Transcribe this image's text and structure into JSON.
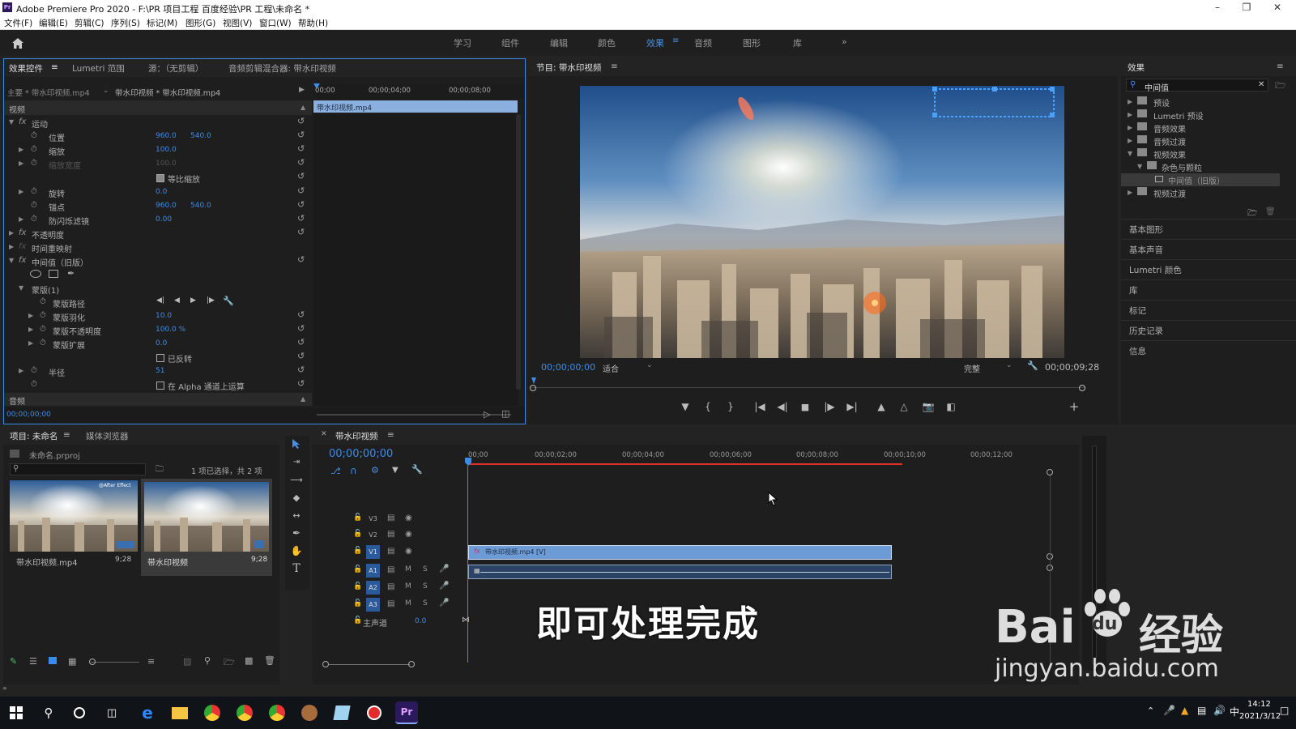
{
  "window": {
    "title": "Adobe Premiere Pro 2020 - F:\\PR 项目工程 百度经验\\PR 工程\\未命名 *",
    "app_icon": "Pr"
  },
  "menu": [
    "文件(F)",
    "编辑(E)",
    "剪辑(C)",
    "序列(S)",
    "标记(M)",
    "图形(G)",
    "视图(V)",
    "窗口(W)",
    "帮助(H)"
  ],
  "workspaces": {
    "tabs": [
      "学习",
      "组件",
      "编辑",
      "颜色",
      "效果",
      "音频",
      "图形",
      "库"
    ],
    "active": "效果",
    "more": "»"
  },
  "effect_controls": {
    "tabs": [
      "效果控件",
      "Lumetri 范围",
      "源：（无剪辑）",
      "音频剪辑混合器: 带水印视频"
    ],
    "master": "主要 * 带水印视频.mp4",
    "clip": "带水印视频 * 带水印视频.mp4",
    "section_video": "视频",
    "section_audio": "音频",
    "timecode": "00;00;00;00",
    "ruler": [
      "00;00",
      "00;00;04;00",
      "00;00;08;00"
    ],
    "clip_bar": "带水印视频.mp4",
    "motion": "运动",
    "position_label": "位置",
    "position_x": "960.0",
    "position_y": "540.0",
    "scale_label": "缩放",
    "scale": "100.0",
    "scale_width_label": "缩放宽度",
    "scale_width": "100.0",
    "uniform_label": "等比缩放",
    "rotation_label": "旋转",
    "rotation": "0.0",
    "anchor_label": "锚点",
    "anchor_x": "960.0",
    "anchor_y": "540.0",
    "flicker_label": "防闪烁滤镜",
    "flicker": "0.00",
    "opacity_label": "不透明度",
    "timeremap_label": "时间重映射",
    "median_label": "中间值（旧版）",
    "mask_label": "蒙版(1)",
    "mask_path_label": "蒙版路径",
    "mask_feather_label": "蒙版羽化",
    "mask_feather": "10.0",
    "mask_opacity_label": "蒙版不透明度",
    "mask_opacity": "100.0 %",
    "mask_expand_label": "蒙版扩展",
    "mask_expand": "0.0",
    "inverted_label": "已反转",
    "radius_label": "半径",
    "radius": "51",
    "alpha_label": "在 Alpha 通道上运算"
  },
  "program": {
    "title": "节目: 带水印视频",
    "timecode": "00;00;00;00",
    "fit": "适合",
    "quality": "完整",
    "duration": "00;00;09;28"
  },
  "effects_panel": {
    "title": "效果",
    "search_value": "中间值",
    "tree": [
      {
        "label": "预设",
        "level": 0,
        "open": false
      },
      {
        "label": "Lumetri 预设",
        "level": 0,
        "open": false
      },
      {
        "label": "音频效果",
        "level": 0,
        "open": false
      },
      {
        "label": "音频过渡",
        "level": 0,
        "open": false
      },
      {
        "label": "视频效果",
        "level": 0,
        "open": true
      },
      {
        "label": "杂色与颗粒",
        "level": 1,
        "open": true
      },
      {
        "label": "中间值（旧版）",
        "level": 2,
        "open": false
      },
      {
        "label": "视频过渡",
        "level": 0,
        "open": false
      }
    ],
    "sections": [
      "基本图形",
      "基本声音",
      "Lumetri 颜色",
      "库",
      "标记",
      "历史记录",
      "信息"
    ]
  },
  "project": {
    "tabs": [
      "项目: 未命名",
      "媒体浏览器"
    ],
    "file": "未命名.prproj",
    "selection": "1 项已选择，共 2 项",
    "items": [
      {
        "name": "带水印视频.mp4",
        "duration": "9;28",
        "badge": "@After Effect"
      },
      {
        "name": "带水印视频",
        "duration": "9;28",
        "badge": ""
      }
    ]
  },
  "timeline": {
    "title": "带水印视频",
    "timecode": "00;00;00;00",
    "ruler": [
      "00;00",
      "00;00;02;00",
      "00;00;04;00",
      "00;00;06;00",
      "00;00;08;00",
      "00;00;10;00",
      "00;00;12;00"
    ],
    "video_tracks": [
      "V3",
      "V2",
      "V1"
    ],
    "audio_tracks": [
      "A1",
      "A2",
      "A3"
    ],
    "master_label": "主声道",
    "master_value": "0.0",
    "clip_label": "带水印视频.mp4 [V]",
    "track_m": "M",
    "track_s": "S"
  },
  "caption": "即可处理完成",
  "watermark": {
    "brand_a": "Bai",
    "brand_b": "du",
    "brand_c": "经验",
    "url": "jingyan.baidu.com"
  },
  "taskbar": {
    "time": "14:12",
    "date": "2021/3/12",
    "ime": "中"
  },
  "colors": {
    "accent": "#3c8ce7",
    "clip": "#6d9bd6",
    "panel": "#1e1e1e",
    "playhead": "#3c8ce7"
  }
}
